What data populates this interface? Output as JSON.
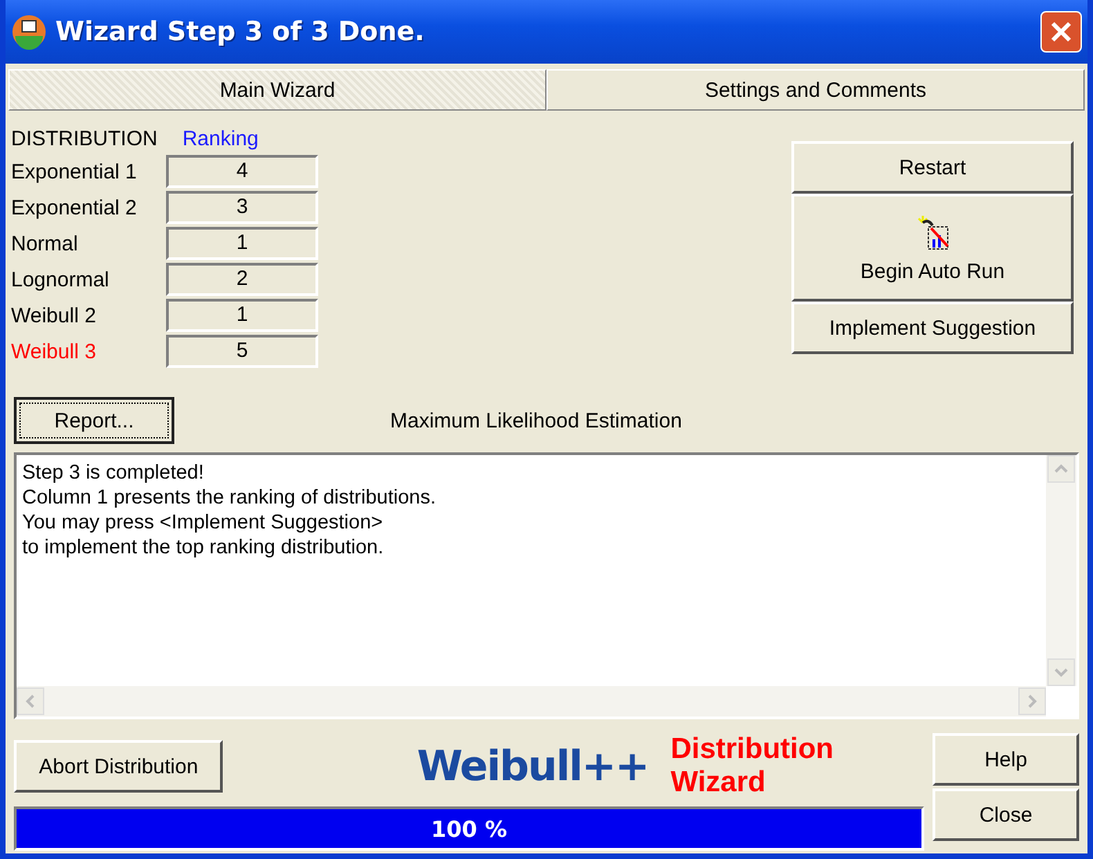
{
  "window": {
    "title": "Wizard Step 3 of 3 Done."
  },
  "tabs": [
    {
      "label": "Main Wizard",
      "selected": true
    },
    {
      "label": "Settings and Comments",
      "selected": false
    }
  ],
  "distribution_header": "DISTRIBUTION",
  "ranking_header": "Ranking",
  "distributions": [
    {
      "name": "Exponential 1",
      "rank": "4",
      "color": "#000000"
    },
    {
      "name": "Exponential 2",
      "rank": "3",
      "color": "#000000"
    },
    {
      "name": "Normal",
      "rank": "1",
      "color": "#000000"
    },
    {
      "name": "Lognormal",
      "rank": "2",
      "color": "#000000"
    },
    {
      "name": "Weibull 2",
      "rank": "1",
      "color": "#000000"
    },
    {
      "name": "Weibull 3",
      "rank": "5",
      "color": "#ff0000"
    }
  ],
  "side_buttons": [
    {
      "label": "Restart",
      "kind": "plain"
    },
    {
      "label": "Begin Auto Run",
      "kind": "icon"
    },
    {
      "label": "Implement Suggestion",
      "kind": "plain"
    }
  ],
  "report_button": "Report...",
  "method": "Maximum Likelihood Estimation",
  "message_lines": [
    "Step 3 is completed!",
    "Column 1 presents the ranking of distributions.",
    "You may press <Implement Suggestion>",
    "to implement the top ranking distribution."
  ],
  "abort_button": "Abort Distribution",
  "logo": {
    "product": "Weibull++",
    "subtitle": "Distribution Wizard"
  },
  "help_button": "Help",
  "close_button": "Close",
  "progress": {
    "level": 1,
    "reading": "100 %"
  }
}
